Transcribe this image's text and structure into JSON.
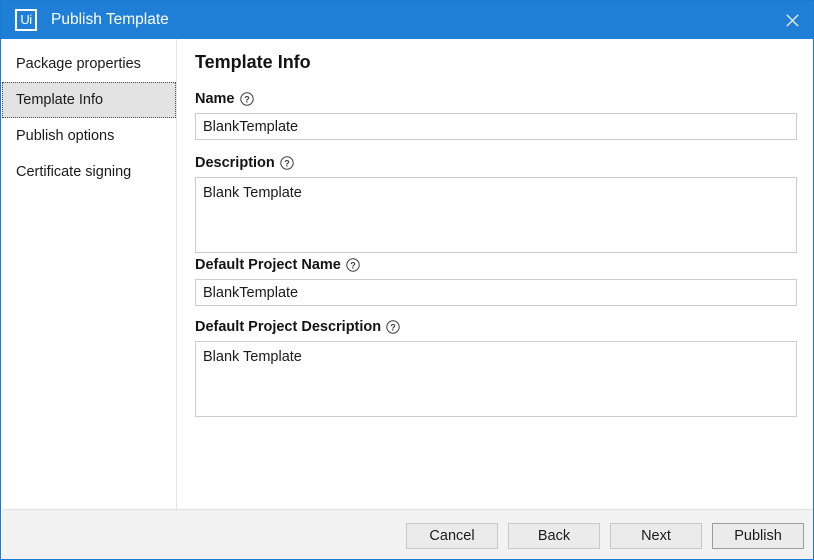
{
  "window": {
    "title": "Publish Template",
    "logo_text": "Ui",
    "logo_icon": "uipath-logo-icon",
    "close_icon": "close-icon",
    "accent_color": "#1f7fd6"
  },
  "sidebar": {
    "items": [
      {
        "label": "Package properties",
        "selected": false
      },
      {
        "label": "Template Info",
        "selected": true
      },
      {
        "label": "Publish options",
        "selected": false
      },
      {
        "label": "Certificate signing",
        "selected": false
      }
    ]
  },
  "main": {
    "title": "Template Info",
    "help_icon": "help-circle-icon",
    "fields": [
      {
        "label": "Name",
        "value": "BlankTemplate",
        "placeholder": "",
        "type": "input"
      },
      {
        "label": "Description",
        "value": "Blank Template",
        "placeholder": "",
        "type": "textarea"
      },
      {
        "label": "Default Project Name",
        "value": "BlankTemplate",
        "placeholder": "",
        "type": "input"
      },
      {
        "label": "Default Project Description",
        "value": "Blank Template",
        "placeholder": "",
        "type": "textarea"
      }
    ]
  },
  "footer": {
    "cancel_label": "Cancel",
    "back_label": "Back",
    "next_label": "Next",
    "publish_label": "Publish"
  }
}
